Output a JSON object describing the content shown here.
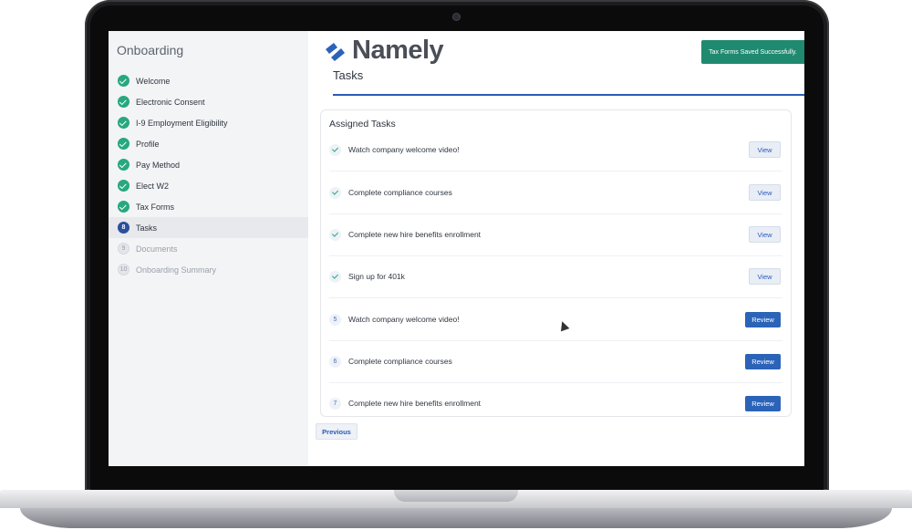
{
  "app": {
    "brand": "Namely",
    "toast": "Tax Forms Saved Successfully.",
    "page_title": "Tasks"
  },
  "sidebar": {
    "title": "Onboarding",
    "items": [
      {
        "label": "Welcome",
        "state": "done",
        "num": ""
      },
      {
        "label": "Electronic Consent",
        "state": "done",
        "num": ""
      },
      {
        "label": "I-9 Employment Eligibility",
        "state": "done",
        "num": ""
      },
      {
        "label": "Profile",
        "state": "done",
        "num": ""
      },
      {
        "label": "Pay Method",
        "state": "done",
        "num": ""
      },
      {
        "label": "Elect W2",
        "state": "done",
        "num": ""
      },
      {
        "label": "Tax Forms",
        "state": "done",
        "num": ""
      },
      {
        "label": "Tasks",
        "state": "current",
        "num": "8"
      },
      {
        "label": "Documents",
        "state": "todo",
        "num": "9"
      },
      {
        "label": "Onboarding Summary",
        "state": "todo",
        "num": "10"
      }
    ]
  },
  "tasks": {
    "title": "Assigned Tasks",
    "rows": [
      {
        "num": "",
        "done": true,
        "label": "Watch company welcome video!",
        "action": "View"
      },
      {
        "num": "",
        "done": true,
        "label": "Complete compliance courses",
        "action": "View"
      },
      {
        "num": "",
        "done": true,
        "label": "Complete new hire benefits enrollment",
        "action": "View"
      },
      {
        "num": "",
        "done": true,
        "label": "Sign up for 401k",
        "action": "View"
      },
      {
        "num": "5",
        "done": false,
        "label": "Watch company welcome video!",
        "action": "Review"
      },
      {
        "num": "6",
        "done": false,
        "label": "Complete compliance courses",
        "action": "Review"
      },
      {
        "num": "7",
        "done": false,
        "label": "Complete new hire benefits enrollment",
        "action": "Review"
      }
    ]
  },
  "footer": {
    "previous_label": "Previous"
  },
  "colors": {
    "accent": "#2b63b8",
    "success": "#27a87e",
    "toast": "#1f8a70"
  }
}
